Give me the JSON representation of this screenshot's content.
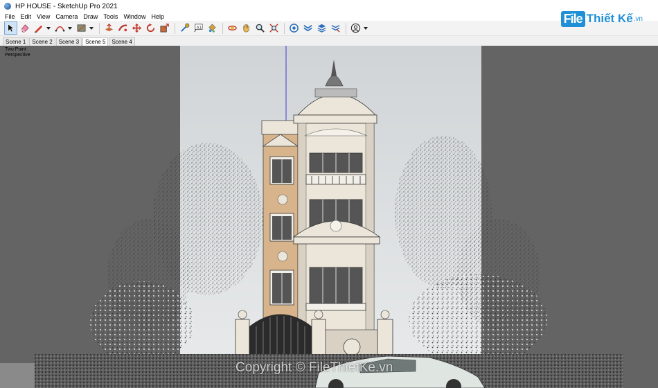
{
  "window": {
    "title": "HP HOUSE - SketchUp Pro 2021"
  },
  "menu": [
    "File",
    "Edit",
    "View",
    "Camera",
    "Draw",
    "Tools",
    "Window",
    "Help"
  ],
  "toolbar": {
    "tools": [
      {
        "name": "select-tool",
        "icon": "arrow-cursor-icon",
        "active": true
      },
      {
        "name": "eraser-tool",
        "icon": "eraser-icon"
      },
      {
        "name": "line-tool",
        "icon": "pencil-icon",
        "dropdown": true
      },
      {
        "name": "arc-tool",
        "icon": "arc-icon",
        "dropdown": true
      },
      {
        "name": "shape-tool",
        "icon": "rectangle-icon",
        "dropdown": true
      },
      {
        "name": "push-pull-tool",
        "icon": "push-pull-icon"
      },
      {
        "name": "follow-me-tool",
        "icon": "follow-me-icon"
      },
      {
        "name": "move-tool",
        "icon": "move-icon"
      },
      {
        "name": "rotate-tool",
        "icon": "rotate-icon"
      },
      {
        "name": "scale-tool",
        "icon": "scale-icon"
      },
      {
        "name": "tape-measure-tool",
        "icon": "tape-measure-icon"
      },
      {
        "name": "text-tool",
        "icon": "text-icon"
      },
      {
        "name": "paint-bucket-tool",
        "icon": "paint-bucket-icon"
      },
      {
        "name": "orbit-tool",
        "icon": "orbit-icon"
      },
      {
        "name": "pan-tool",
        "icon": "hand-icon"
      },
      {
        "name": "zoom-tool",
        "icon": "magnifier-icon"
      },
      {
        "name": "zoom-extents-tool",
        "icon": "zoom-extents-icon"
      },
      {
        "name": "warehouse-tool",
        "icon": "warehouse-icon"
      },
      {
        "name": "extension-warehouse-tool",
        "icon": "extension-warehouse-icon"
      },
      {
        "name": "layout-tool",
        "icon": "layout-icon"
      },
      {
        "name": "extension-manager-tool",
        "icon": "extension-manager-icon"
      },
      {
        "name": "account-tool",
        "icon": "user-circle-icon",
        "dropdown": true
      }
    ]
  },
  "logo": {
    "box": "File",
    "text": "Thiết Kế",
    "tld": ".vn"
  },
  "scenes": {
    "tabs": [
      "Scene 1",
      "Scene 2",
      "Scene 3",
      "Scene 5",
      "Scene 4"
    ],
    "active": "Scene 5"
  },
  "viewport": {
    "label_line1": "Two Point",
    "label_line2": "Perspective",
    "watermark": "Copyright © FileThietKe.vn"
  },
  "colors": {
    "accent": "#1f8fd6",
    "facade": "#d8b48c",
    "trim": "#ece6da",
    "sky": "#dfe2e3",
    "side": "#646464"
  }
}
